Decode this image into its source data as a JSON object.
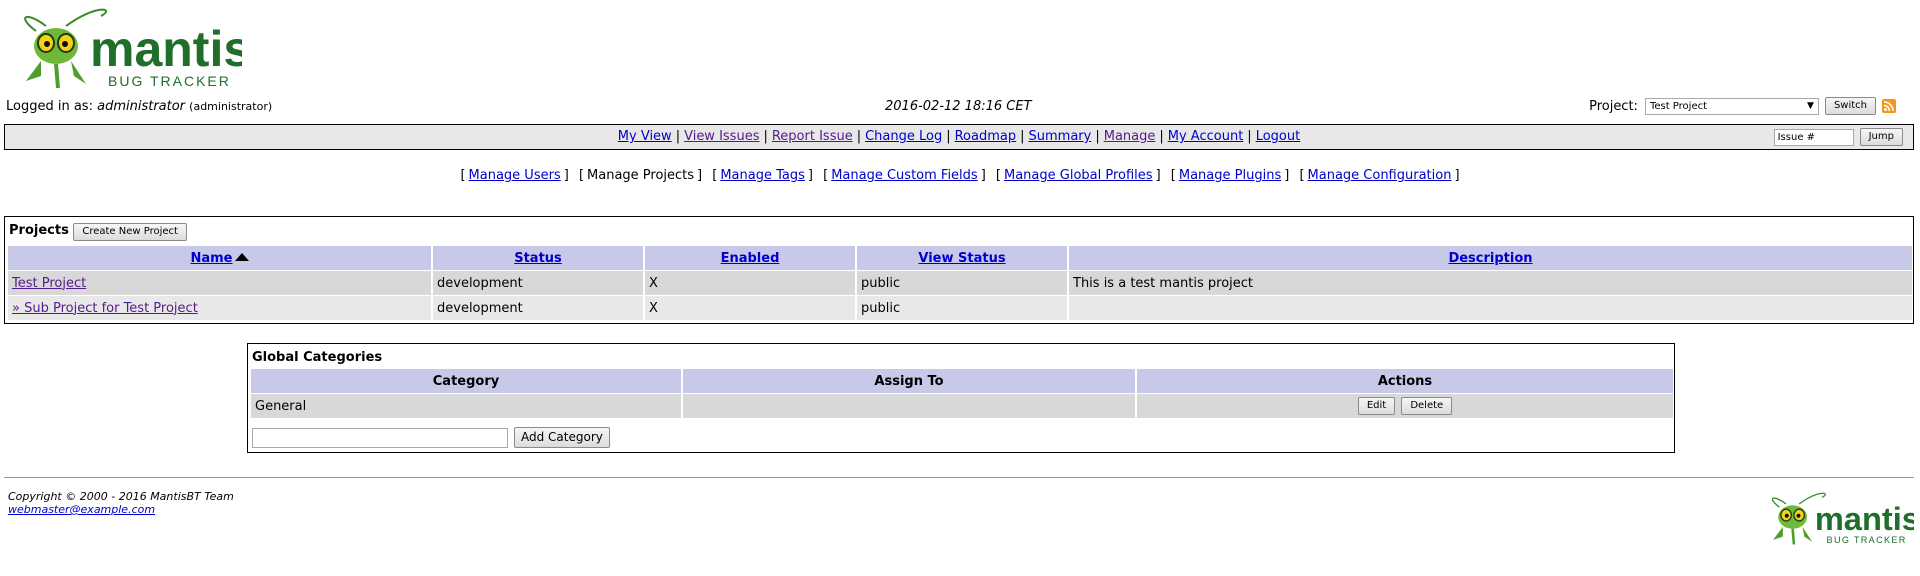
{
  "brand": {
    "name": "mantis",
    "tagline": "BUG TRACKER",
    "green": "#1f6e2a",
    "accent": "#f7941d"
  },
  "header": {
    "logged_in_label": "Logged in as:",
    "username": "administrator",
    "role": "(administrator)",
    "datetime": "2016-02-12 18:16 CET",
    "project_label": "Project:",
    "project_selected": "Test Project",
    "switch_label": "Switch",
    "rss_icon": "rss-icon"
  },
  "main_menu": {
    "items": [
      {
        "label": "My View"
      },
      {
        "label": "View Issues"
      },
      {
        "label": "Report Issue"
      },
      {
        "label": "Change Log"
      },
      {
        "label": "Roadmap"
      },
      {
        "label": "Summary"
      },
      {
        "label": "Manage"
      },
      {
        "label": "My Account"
      },
      {
        "label": "Logout"
      }
    ],
    "issue_placeholder": "Issue #",
    "jump_label": "Jump"
  },
  "sub_menu": {
    "items": [
      {
        "label": "Manage Users"
      },
      {
        "label": "Manage Projects"
      },
      {
        "label": "Manage Tags"
      },
      {
        "label": "Manage Custom Fields"
      },
      {
        "label": "Manage Global Profiles"
      },
      {
        "label": "Manage Plugins"
      },
      {
        "label": "Manage Configuration"
      }
    ]
  },
  "projects": {
    "title": "Projects",
    "create_label": "Create New Project",
    "columns": [
      "Name",
      "Status",
      "Enabled",
      "View Status",
      "Description"
    ],
    "rows": [
      {
        "name": "Test Project",
        "status": "development",
        "enabled": "X",
        "view_status": "public",
        "description": "This is a test mantis project"
      },
      {
        "name": "» Sub Project for Test Project",
        "status": "development",
        "enabled": "X",
        "view_status": "public",
        "description": ""
      }
    ]
  },
  "categories": {
    "title": "Global Categories",
    "columns": [
      "Category",
      "Assign To",
      "Actions"
    ],
    "rows": [
      {
        "category": "General",
        "assign_to": "",
        "edit_label": "Edit",
        "delete_label": "Delete"
      }
    ],
    "add_label": "Add Category"
  },
  "footer": {
    "copyright": "Copyright © 2000 - 2016 MantisBT Team",
    "webmaster": "webmaster@example.com"
  }
}
